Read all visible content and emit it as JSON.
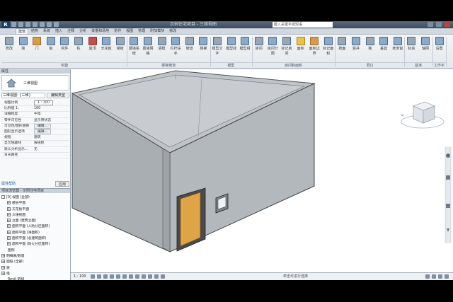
{
  "title_bar": {
    "window_title": "示例住宅项目 - 三维视图",
    "search_placeholder": "键入关键字或短语"
  },
  "tabs": [
    "建筑",
    "结构",
    "系统",
    "插入",
    "注释",
    "分析",
    "体量和场地",
    "协作",
    "视图",
    "管理",
    "附加模块",
    "修改"
  ],
  "active_tab": 0,
  "ribbon": {
    "buttons": [
      {
        "label": "修改",
        "icon": "cursor-icon",
        "color": "g"
      },
      {
        "label": "墙",
        "icon": "wall-icon",
        "color": "b"
      },
      {
        "label": "门",
        "icon": "door-icon",
        "color": "o"
      },
      {
        "label": "窗",
        "icon": "window-icon",
        "color": "b"
      },
      {
        "label": "构件",
        "icon": "component-icon",
        "color": "b"
      },
      {
        "label": "柱",
        "icon": "column-icon",
        "color": "g"
      },
      {
        "label": "屋顶",
        "icon": "roof-icon",
        "color": "r"
      },
      {
        "label": "天花板",
        "icon": "ceiling-icon",
        "color": "b"
      },
      {
        "label": "楼板",
        "icon": "floor-icon",
        "color": "g"
      },
      {
        "label": "幕墙系统",
        "icon": "curtain-system-icon",
        "color": "b"
      },
      {
        "label": "幕墙网格",
        "icon": "curtain-grid-icon",
        "color": "b"
      },
      {
        "label": "竖梃",
        "icon": "mullion-icon",
        "color": "g"
      },
      {
        "label": "栏杆扶手",
        "icon": "railing-icon",
        "color": "b"
      },
      {
        "label": "坡道",
        "icon": "ramp-icon",
        "color": "g"
      },
      {
        "label": "楼梯",
        "icon": "stair-icon",
        "color": "b"
      },
      {
        "label": "模型文字",
        "icon": "model-text-icon",
        "color": "g"
      },
      {
        "label": "模型线",
        "icon": "model-line-icon",
        "color": "b"
      },
      {
        "label": "模型组",
        "icon": "model-group-icon",
        "color": "b"
      },
      {
        "label": "房间",
        "icon": "room-icon",
        "color": "g"
      },
      {
        "label": "房间分隔",
        "icon": "room-separator-icon",
        "color": "b"
      },
      {
        "label": "标记房间",
        "icon": "tag-room-icon",
        "color": "g"
      },
      {
        "label": "面积",
        "icon": "area-icon",
        "color": "y"
      },
      {
        "label": "面积边界",
        "icon": "area-boundary-icon",
        "color": "o"
      },
      {
        "label": "标记面积",
        "icon": "tag-area-icon",
        "color": "b"
      },
      {
        "label": "按面",
        "icon": "by-face-icon",
        "color": "g"
      },
      {
        "label": "竖井",
        "icon": "shaft-icon",
        "color": "b"
      },
      {
        "label": "墙",
        "icon": "wall-opening-icon",
        "color": "g"
      },
      {
        "label": "垂直",
        "icon": "vertical-opening-icon",
        "color": "b"
      },
      {
        "label": "老虎窗",
        "icon": "dormer-icon",
        "color": "b"
      },
      {
        "label": "标高",
        "icon": "level-icon",
        "color": "g"
      },
      {
        "label": "轴网",
        "icon": "grid-icon",
        "color": "b"
      },
      {
        "label": "设置",
        "icon": "set-icon",
        "color": "b"
      }
    ],
    "panels": [
      "构建",
      "楼梯坡道",
      "模型",
      "房间和面积",
      "洞口",
      "基准",
      "工作平面"
    ]
  },
  "properties": {
    "title": "属性",
    "type_name": "三维视图",
    "instance_selector": "三维视图: {三维}",
    "edit_type_label": "编辑类型",
    "rows": [
      {
        "k": "视图比例",
        "v": "1 : 100",
        "style": "box"
      },
      {
        "k": "比例值 1:",
        "v": "100",
        "style": ""
      },
      {
        "k": "详细程度",
        "v": "中等",
        "style": ""
      },
      {
        "k": "零件可见性",
        "v": "显示原状态",
        "style": ""
      },
      {
        "k": "可见性/图形替换",
        "v": "编辑...",
        "style": "btn"
      },
      {
        "k": "图形显示选项",
        "v": "编辑...",
        "style": "btn"
      },
      {
        "k": "规程",
        "v": "建筑",
        "style": ""
      },
      {
        "k": "显示隐藏线",
        "v": "按规程",
        "style": ""
      },
      {
        "k": "默认分析显示...",
        "v": "无",
        "style": ""
      },
      {
        "k": "日光路径",
        "v": "",
        "style": ""
      }
    ],
    "help_link": "属性帮助",
    "apply_label": "应用"
  },
  "browser": {
    "title": "项目浏览器 - 示例住宅项目",
    "items": [
      {
        "indent": 0,
        "toggle": "-",
        "label": "[0] 视图 (全部)"
      },
      {
        "indent": 1,
        "toggle": "+",
        "label": "楼层平面"
      },
      {
        "indent": 1,
        "toggle": "+",
        "label": "天花板平面"
      },
      {
        "indent": 1,
        "toggle": "+",
        "label": "三维视图"
      },
      {
        "indent": 1,
        "toggle": "+",
        "label": "立面 (建筑立面)"
      },
      {
        "indent": 1,
        "toggle": "+",
        "label": "面积平面 (人防分区面积)"
      },
      {
        "indent": 1,
        "toggle": "+",
        "label": "面积平面 (净面积)"
      },
      {
        "indent": 1,
        "toggle": "+",
        "label": "面积平面 (总建筑面积)"
      },
      {
        "indent": 1,
        "toggle": "+",
        "label": "面积平面 (防火分区面积)"
      },
      {
        "indent": 0,
        "toggle": "",
        "label": "图例"
      },
      {
        "indent": 0,
        "toggle": "+",
        "label": "明细表/数量"
      },
      {
        "indent": 0,
        "toggle": "+",
        "label": "图纸 (全部)"
      },
      {
        "indent": 0,
        "toggle": "+",
        "label": "族"
      },
      {
        "indent": 0,
        "toggle": "+",
        "label": "组"
      },
      {
        "indent": 0,
        "toggle": "",
        "label": "Revit 链接"
      }
    ]
  },
  "status": {
    "scale": "1 : 100",
    "text": "单击可进行选择"
  }
}
